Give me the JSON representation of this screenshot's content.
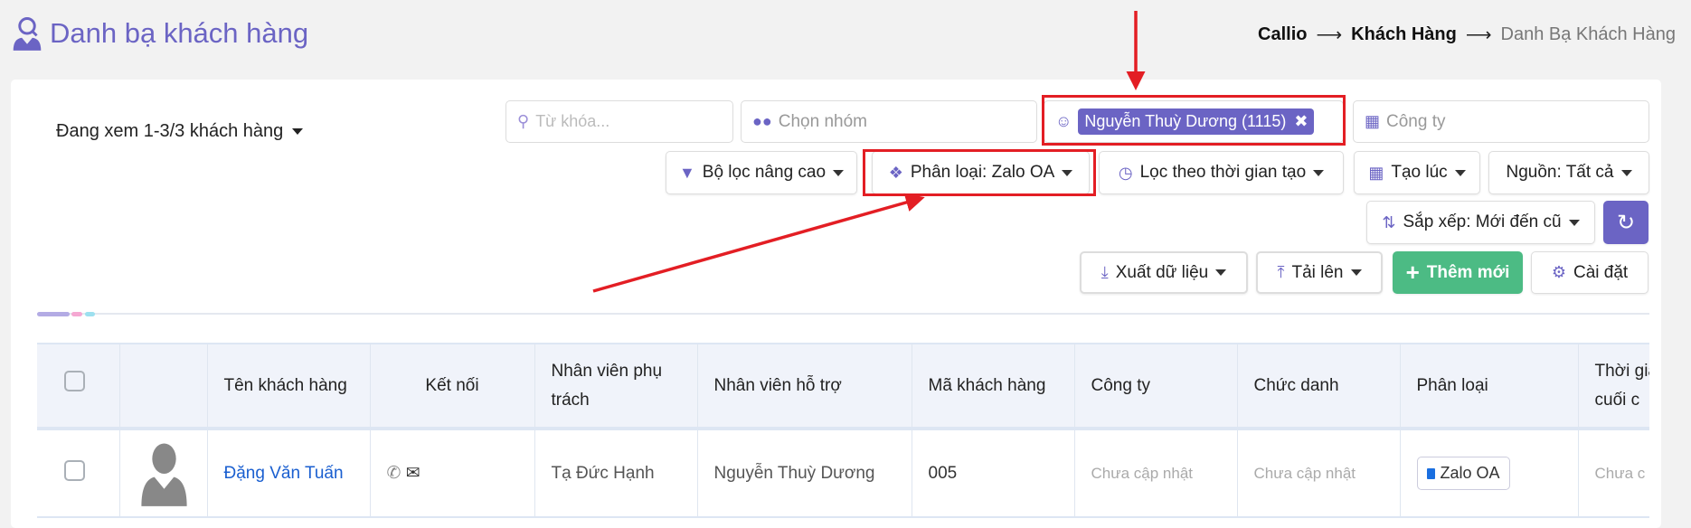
{
  "page": {
    "title": "Danh bạ khách hàng"
  },
  "breadcrumb": {
    "items": [
      "Callio",
      "Khách Hàng",
      "Danh Bạ Khách Hàng"
    ],
    "separator": "⟶"
  },
  "toolbar": {
    "viewing": "Đang xem 1-3/3 khách hàng",
    "search_placeholder": "Từ khóa...",
    "group_placeholder": "Chọn nhóm",
    "selected_staff": "Nguyễn Thuỳ Dương (1115)",
    "company_placeholder": "Công ty",
    "advanced_filter": "Bộ lọc nâng cao",
    "category_filter": "Phân loại: Zalo OA",
    "time_filter": "Lọc theo thời gian tạo",
    "created_at": "Tạo lúc",
    "source": "Nguồn: Tất cả",
    "sort": "Sắp xếp: Mới đến cũ",
    "export": "Xuất dữ liệu",
    "upload": "Tải lên",
    "add_new": "Thêm mới",
    "settings": "Cài đặt"
  },
  "table": {
    "headers": [
      "",
      "",
      "Tên khách hàng",
      "Kết nối",
      "Nhân viên phụ trách",
      "Nhân viên hỗ trợ",
      "Mã khách hàng",
      "Công ty",
      "Chức danh",
      "Phân loại",
      "Thời gian cuối c"
    ],
    "rows": [
      {
        "name": "Đặng Văn Tuấn",
        "owner": "Tạ Đức Hạnh",
        "support": "Nguyễn Thuỳ Dương",
        "code": "005",
        "company": "Chưa cập nhật",
        "position": "Chưa cập nhật",
        "category": "Zalo OA",
        "last": "Chưa c"
      }
    ]
  },
  "colors": {
    "accent": "#6b64c4",
    "success": "#4cbb84",
    "annotation": "#e31e24",
    "link": "#1a5fd0"
  }
}
